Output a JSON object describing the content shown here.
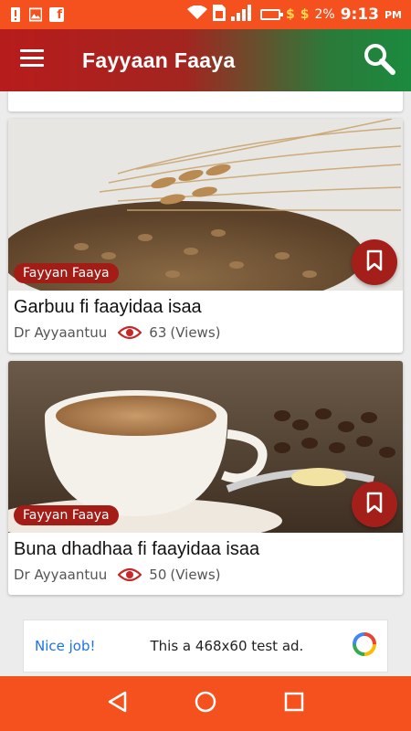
{
  "status_bar": {
    "battery_percent": "2%",
    "time": "9:13",
    "ampm": "PM",
    "colors": {
      "background": "#f4511e",
      "money_icons": "#ffb300"
    },
    "icons": [
      "alert-icon",
      "image-icon",
      "facebook-icon",
      "wifi-icon",
      "sim-icon",
      "signal-icon",
      "battery-icon"
    ]
  },
  "app_bar": {
    "title": "Fayyaan Faaya",
    "menu_icon": "hamburger-menu-icon",
    "search_icon": "search-icon",
    "gradient": [
      "#b71c1c",
      "#1b8a3f"
    ]
  },
  "articles": [
    {
      "category": "Fayyan Faaya",
      "title": "Garbuu fi faayidaa isaa",
      "author": "Dr Ayyaantuu",
      "views": "63",
      "views_suffix": "(Views)",
      "image_subject": "barley grains"
    },
    {
      "category": "Fayyan Faaya",
      "title": "Buna dhadhaa fi faayidaa isaa",
      "author": "Dr Ayyaantuu",
      "views": "50",
      "views_suffix": "(Views)",
      "image_subject": "butter coffee"
    }
  ],
  "ad": {
    "label": "Nice job!",
    "text": "This a 468x60 test ad."
  },
  "nav": {
    "icons": [
      "back-icon",
      "home-icon",
      "recents-icon"
    ]
  },
  "colors": {
    "accent_red": "#a31c16",
    "eye_red": "#c62828",
    "nav_orange": "#f4511e"
  }
}
